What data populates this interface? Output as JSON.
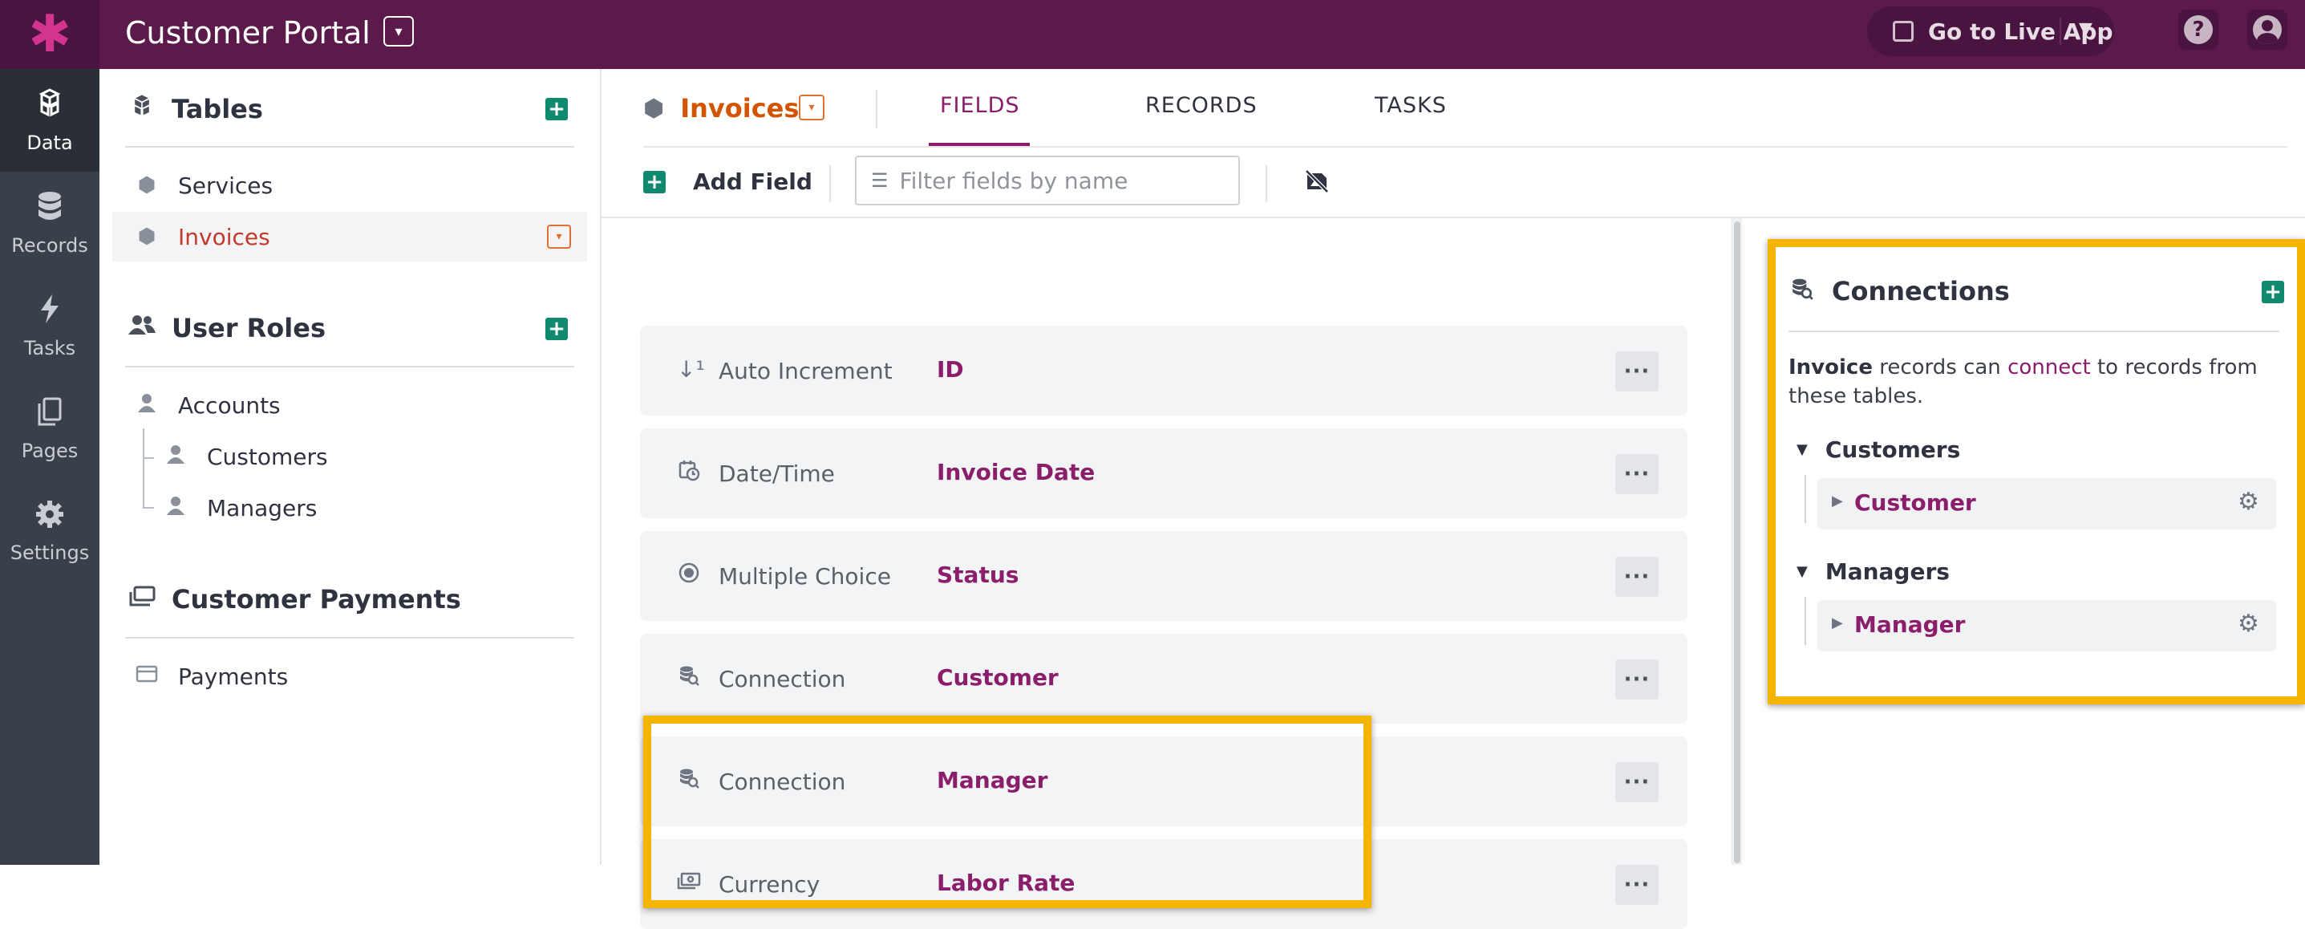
{
  "app": {
    "title": "Customer Portal",
    "logo_icon": "asterisk-logo"
  },
  "topbar": {
    "live_app_label": "Go to Live App",
    "help_icon": "question-icon",
    "user_icon": "user-avatar-icon"
  },
  "leftnav": {
    "items": [
      {
        "label": "Data",
        "icon": "cubes-icon",
        "active": true
      },
      {
        "label": "Records",
        "icon": "database-icon",
        "active": false
      },
      {
        "label": "Tasks",
        "icon": "bolt-icon",
        "active": false
      },
      {
        "label": "Pages",
        "icon": "pages-icon",
        "active": false
      },
      {
        "label": "Settings",
        "icon": "gear-icon",
        "active": false
      }
    ]
  },
  "sidebar": {
    "tables_heading": "Tables",
    "tables": [
      {
        "label": "Services",
        "active": false
      },
      {
        "label": "Invoices",
        "active": true
      }
    ],
    "roles_heading": "User Roles",
    "roles": [
      {
        "label": "Accounts"
      },
      {
        "label": "Customers"
      },
      {
        "label": "Managers"
      }
    ],
    "payments_heading": "Customer Payments",
    "payments": [
      {
        "label": "Payments"
      }
    ]
  },
  "main": {
    "table_name": "Invoices",
    "tabs": [
      {
        "label": "FIELDS",
        "active": true
      },
      {
        "label": "RECORDS",
        "active": false
      },
      {
        "label": "TASKS",
        "active": false
      }
    ],
    "add_field_label": "Add Field",
    "filter_placeholder": "Filter fields by name",
    "fields": [
      {
        "type": "Auto Increment",
        "name": "ID",
        "icon": "sort-numeric-icon"
      },
      {
        "type": "Date/Time",
        "name": "Invoice Date",
        "icon": "calendar-clock-icon"
      },
      {
        "type": "Multiple Choice",
        "name": "Status",
        "icon": "radio-icon"
      },
      {
        "type": "Connection",
        "name": "Customer",
        "icon": "connection-icon"
      },
      {
        "type": "Connection",
        "name": "Manager",
        "icon": "connection-icon"
      },
      {
        "type": "Currency",
        "name": "Labor Rate",
        "icon": "money-icon"
      }
    ],
    "more_label": "···"
  },
  "connections": {
    "title": "Connections",
    "desc_bold": "Invoice",
    "desc_pre": " records can ",
    "desc_link": "connect",
    "desc_post": " to records from these tables.",
    "groups": [
      {
        "heading": "Customers",
        "items": [
          {
            "label": "Customer"
          }
        ]
      },
      {
        "heading": "Managers",
        "items": [
          {
            "label": "Manager"
          }
        ]
      }
    ]
  },
  "colors": {
    "brand": "#5b1a4a",
    "accent": "#8b1e6b",
    "highlight": "#f5b400",
    "add": "#0f8a6e",
    "active_table": "#d35400"
  }
}
